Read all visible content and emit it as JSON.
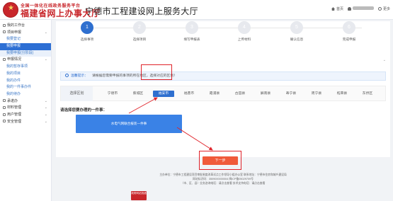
{
  "header": {
    "brand_top": "全国一体化在线政务服务平台",
    "brand_main": "福建省网上办事大厅",
    "site_title": "宁德市工程建设网上服务大厅",
    "home_label": "首页",
    "more_label": "更多"
  },
  "sidebar": {
    "items": [
      {
        "label": "我的工作台",
        "kind": "group"
      },
      {
        "label": "项目申报",
        "kind": "group"
      },
      {
        "label": "我要登记",
        "kind": "sub"
      },
      {
        "label": "我要申报",
        "kind": "sub-active"
      },
      {
        "label": "我要申报(分阶段)",
        "kind": "sub"
      },
      {
        "label": "申报情况",
        "kind": "group"
      },
      {
        "label": "我的暂存事项",
        "kind": "sub"
      },
      {
        "label": "我的项目",
        "kind": "sub"
      },
      {
        "label": "我的办件",
        "kind": "sub"
      },
      {
        "label": "我的一件事办件",
        "kind": "sub"
      },
      {
        "label": "我的待办",
        "kind": "sub"
      },
      {
        "label": "承诺办",
        "kind": "group"
      },
      {
        "label": "材料管理",
        "kind": "group"
      },
      {
        "label": "用户管理",
        "kind": "group"
      },
      {
        "label": "安全管理",
        "kind": "group"
      }
    ]
  },
  "steps": [
    {
      "number": "1",
      "label": "选择事项"
    },
    {
      "number": "2",
      "label": "选择项目"
    },
    {
      "number": "3",
      "label": "填写申报表"
    },
    {
      "number": "4",
      "label": "上传材料"
    },
    {
      "number": "5",
      "label": "确认信息"
    },
    {
      "number": "6",
      "label": "完成申报"
    }
  ],
  "notice": {
    "tip": "温馨提示：",
    "text": "请根据您需要申报的事项的所在地区，选择对应的区划！"
  },
  "region": {
    "label": "选择区划",
    "options": [
      "宁德市",
      "蕉城区",
      "福安市",
      "福鼎市",
      "霞浦县",
      "古田县",
      "屏南县",
      "寿宁县",
      "周宁县",
      "柘荣县",
      "东侨区"
    ],
    "selected_index": 2
  },
  "prompt": "请选择您要办理的一件事：",
  "matter_button": "水电气网联合报装一件事",
  "next_button": "下一步",
  "footer": {
    "line1": "主办单位：宁德市工程建设项目审批制度改革试点工作领导小组办公室   联系地址：宁德市住房和城乡建设局",
    "line2": "网站标识码：3509000000004   闽ICP备05029709号",
    "line3": "（市、区、县）业务咨询电话：请点击查看   技术支持电话：请点击查看",
    "badge": "政府网站找错"
  },
  "colors": {
    "primary": "#2e6fcf",
    "highlight": "#e0232a",
    "next": "#f05a3a",
    "brand": "#c8262b"
  }
}
